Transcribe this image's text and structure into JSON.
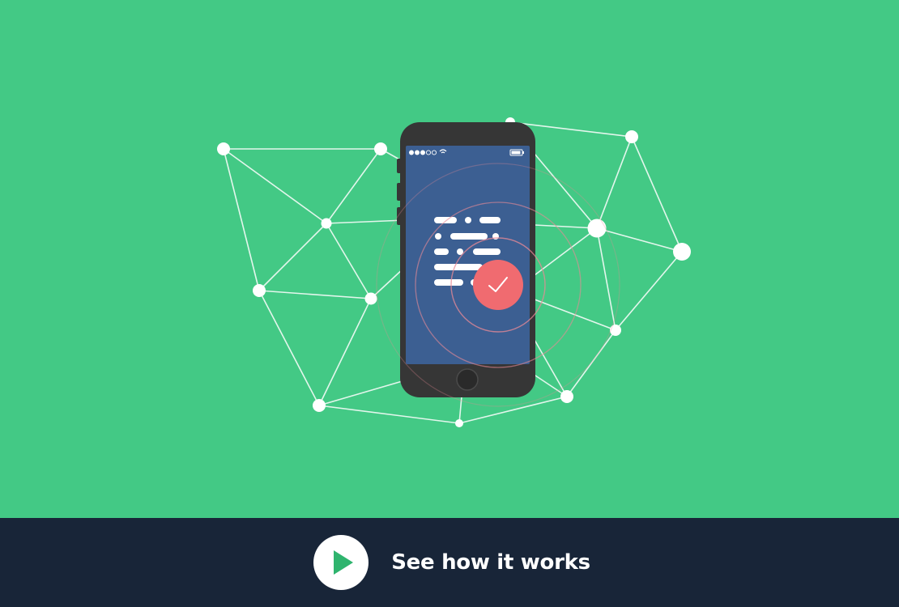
{
  "colors": {
    "hero_background": "#43c985",
    "footer_background": "#182538",
    "network_lines": "#ffffff",
    "phone_body": "#363636",
    "phone_screen": "#3c5f92",
    "check_badge": "#f06b70",
    "ripple_rings": "#e98a96",
    "play_icon": "#2fb46e"
  },
  "hero": {
    "illustration": "smartphone-with-verified-checkmark-in-network",
    "icons": [
      "signal-dots-icon",
      "wifi-icon",
      "battery-icon",
      "checkmark-icon",
      "home-button-icon"
    ]
  },
  "cta": {
    "icon": "play-icon",
    "label": "See how it works"
  }
}
